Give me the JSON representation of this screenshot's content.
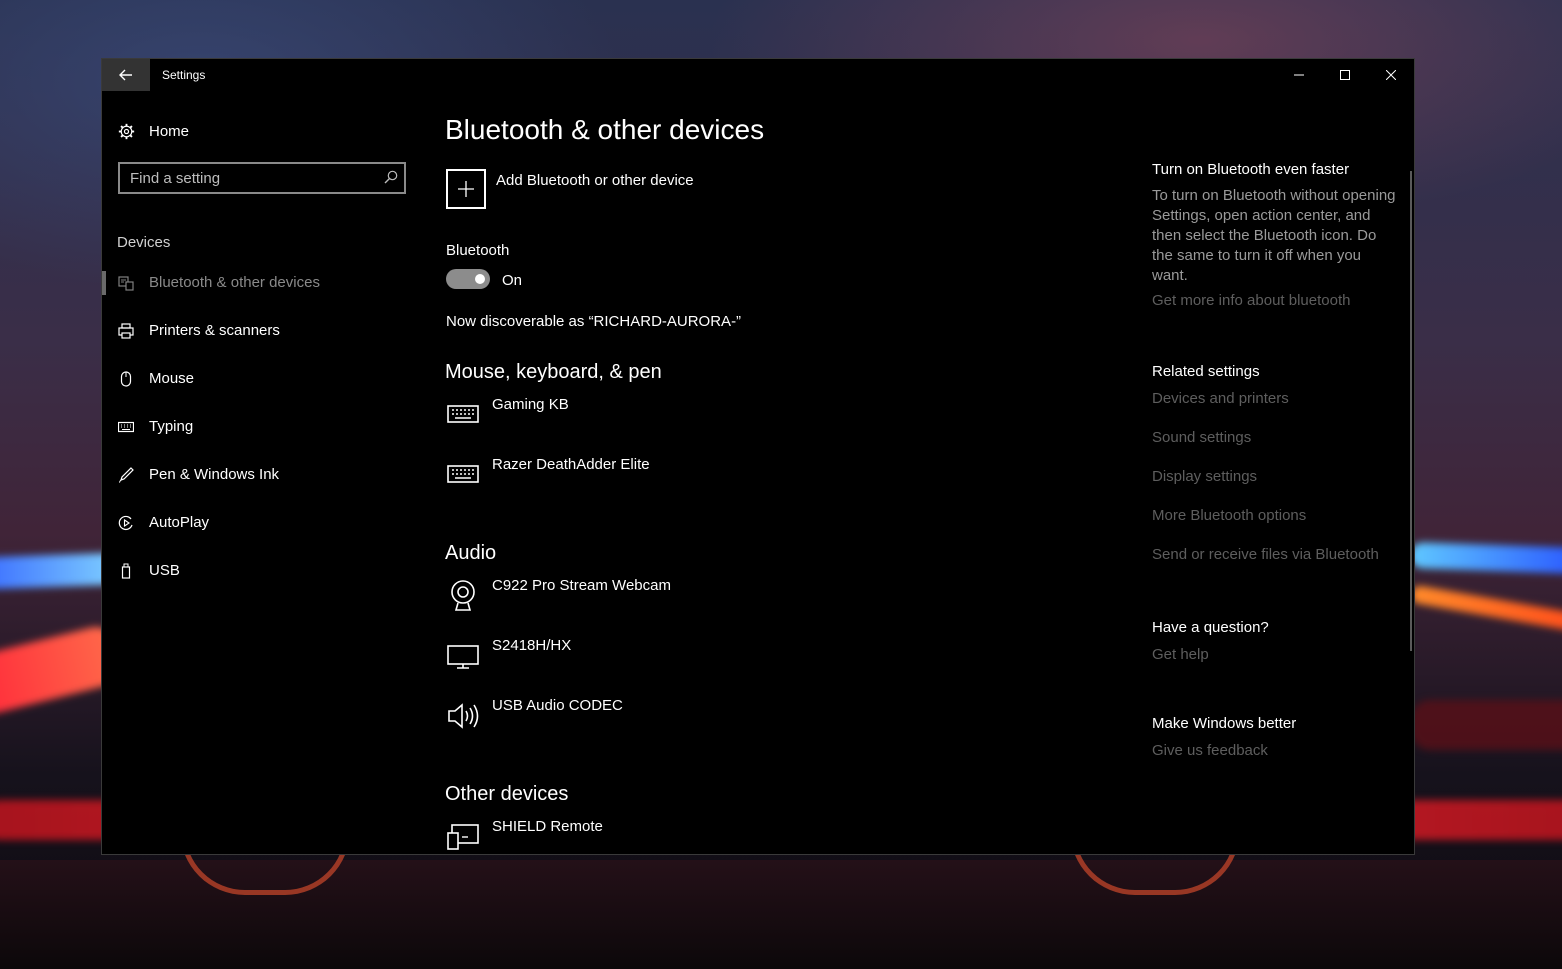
{
  "window": {
    "title": "Settings"
  },
  "nav": {
    "home_label": "Home",
    "search_placeholder": "Find a setting",
    "group_label": "Devices",
    "items": [
      {
        "label": "Bluetooth & other devices",
        "icon": "bluetooth-devices-icon",
        "selected": true
      },
      {
        "label": "Printers & scanners",
        "icon": "printer-icon",
        "selected": false
      },
      {
        "label": "Mouse",
        "icon": "mouse-icon",
        "selected": false
      },
      {
        "label": "Typing",
        "icon": "keyboard-icon",
        "selected": false
      },
      {
        "label": "Pen & Windows Ink",
        "icon": "pen-icon",
        "selected": false
      },
      {
        "label": "AutoPlay",
        "icon": "autoplay-icon",
        "selected": false
      },
      {
        "label": "USB",
        "icon": "usb-icon",
        "selected": false
      }
    ]
  },
  "main": {
    "title": "Bluetooth & other devices",
    "add_device_label": "Add Bluetooth or other device",
    "bluetooth_label": "Bluetooth",
    "bluetooth_state": "On",
    "bluetooth_on": true,
    "discoverable_text": "Now discoverable as “RICHARD-AURORA-”",
    "sections": [
      {
        "heading": "Mouse, keyboard, & pen",
        "devices": [
          {
            "name": "Gaming KB",
            "icon": "keyboard-icon"
          },
          {
            "name": "Razer DeathAdder Elite",
            "icon": "keyboard-icon"
          }
        ]
      },
      {
        "heading": "Audio",
        "devices": [
          {
            "name": "C922 Pro Stream Webcam",
            "icon": "webcam-icon"
          },
          {
            "name": "S2418H/HX",
            "icon": "monitor-icon"
          },
          {
            "name": "USB Audio CODEC",
            "icon": "speaker-icon"
          }
        ]
      },
      {
        "heading": "Other devices",
        "devices": [
          {
            "name": "SHIELD Remote",
            "icon": "generic-device-icon"
          }
        ]
      }
    ]
  },
  "right_panel": {
    "tip_heading": "Turn on Bluetooth even faster",
    "tip_text": "To turn on Bluetooth without opening Settings, open action center, and then select the Bluetooth icon. Do the same to turn it off when you want.",
    "tip_link": "Get more info about bluetooth",
    "related_heading": "Related settings",
    "related_links": [
      "Devices and printers",
      "Sound settings",
      "Display settings",
      "More Bluetooth options",
      "Send or receive files via Bluetooth"
    ],
    "question_heading": "Have a question?",
    "question_link": "Get help",
    "feedback_heading": "Make Windows better",
    "feedback_link": "Give us feedback"
  },
  "colors": {
    "window_bg": "#000000",
    "link_dim": "#5e5e5e",
    "toggle_on": "#8c8c8c"
  }
}
